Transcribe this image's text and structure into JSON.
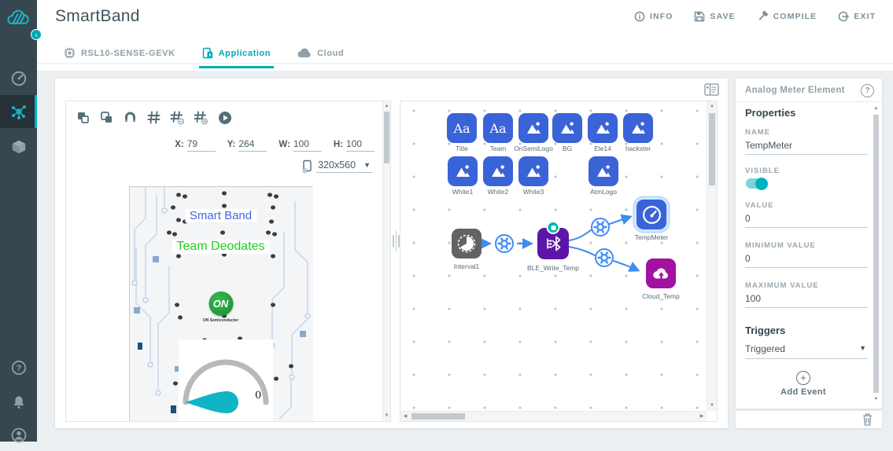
{
  "app": {
    "title": "SmartBand"
  },
  "sidebar": {
    "logo_icon": "cloud-logo",
    "expand_badge_icon": "chevron-right",
    "items": [
      {
        "icon": "gauge-icon",
        "active": false
      },
      {
        "icon": "node-graph-icon",
        "active": true
      },
      {
        "icon": "cube-icon",
        "active": false
      }
    ],
    "bottom_items": [
      {
        "icon": "help-icon"
      },
      {
        "icon": "bell-icon"
      },
      {
        "icon": "user-icon"
      }
    ]
  },
  "header": {
    "title": "SmartBand",
    "actions": [
      {
        "label": "INFO",
        "icon": "info-icon"
      },
      {
        "label": "SAVE",
        "icon": "save-icon"
      },
      {
        "label": "COMPILE",
        "icon": "compile-icon"
      },
      {
        "label": "EXIT",
        "icon": "exit-icon"
      }
    ],
    "tabs": [
      {
        "label": "RSL10-SENSE-GEVK",
        "icon": "chip-icon",
        "active": false
      },
      {
        "label": "Application",
        "icon": "phone-icon",
        "active": true
      },
      {
        "label": "Cloud",
        "icon": "cloud-icon",
        "active": false
      }
    ]
  },
  "designer": {
    "toolbar_icons": [
      "bring-forward",
      "send-backward",
      "snap-magnet",
      "grid",
      "grid-decrease",
      "grid-increase",
      "play"
    ],
    "position_fields": [
      {
        "label": "X:",
        "value": "79"
      },
      {
        "label": "Y:",
        "value": "264"
      },
      {
        "label": "W:",
        "value": "100"
      },
      {
        "label": "H:",
        "value": "100"
      }
    ],
    "device_size": {
      "value": "320x560",
      "icon": "device-add-icon"
    },
    "preview": {
      "app_title": "Smart Band",
      "team_name": "Team Deodates",
      "logo_text": "ON",
      "logo_caption": "ON Semiconductor",
      "meter_value": "0"
    }
  },
  "node_editor": {
    "palette_row1": [
      {
        "label": "Title",
        "type": "text"
      },
      {
        "label": "Team",
        "type": "text"
      },
      {
        "label": "OnSemiLogo",
        "type": "image"
      },
      {
        "label": "BG",
        "type": "image"
      },
      {
        "label": "Ele14",
        "type": "image"
      },
      {
        "label": "hackster",
        "type": "image"
      }
    ],
    "palette_row2": [
      {
        "label": "White1",
        "type": "image"
      },
      {
        "label": "White2",
        "type": "image"
      },
      {
        "label": "White3",
        "type": "image"
      },
      {
        "label": "AtmLogo",
        "type": "image"
      }
    ],
    "flow_nodes": [
      {
        "label": "Interval1",
        "type": "interval"
      },
      {
        "label": "BLE_Write_Temp",
        "type": "bluetooth"
      },
      {
        "label": "TempMeter",
        "type": "analog-meter",
        "selected": true
      },
      {
        "label": "Cloud_Temp",
        "type": "cloud-upload"
      }
    ]
  },
  "properties_panel": {
    "title": "Analog Meter Element",
    "section_title": "Properties",
    "fields": [
      {
        "label": "NAME",
        "value": "TempMeter"
      },
      {
        "label": "VISIBLE",
        "value": "on"
      },
      {
        "label": "VALUE",
        "value": "0"
      },
      {
        "label": "MINIMUM VALUE",
        "value": "0"
      },
      {
        "label": "MAXIMUM VALUE",
        "value": "100"
      }
    ],
    "triggers_title": "Triggers",
    "trigger_selected": "Triggered",
    "add_event_label": "Add Event",
    "delete_icon": "trash-icon"
  },
  "colors": {
    "accent_teal": "#00a9b7",
    "sidebar_bg": "#37474f",
    "node_blue": "#3a63d8",
    "node_purple": "#5c16a7",
    "node_magenta": "#a112a1",
    "node_gray": "#636363",
    "wire_blue": "#3f8cf3",
    "preview_title_blue": "#4169e1",
    "preview_team_green": "#22cc22",
    "on_logo_green": "#21a038"
  }
}
